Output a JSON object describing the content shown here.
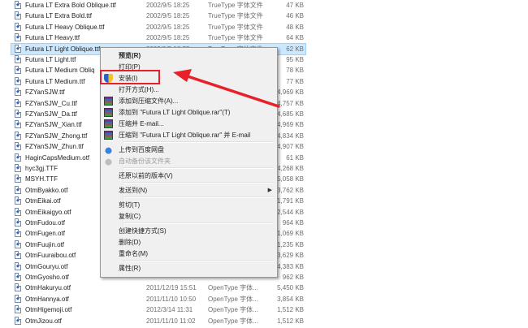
{
  "files": [
    {
      "name": "Futura LT Extra Bold Oblique.ttf",
      "date": "2002/9/5 18:25",
      "type": "TrueType 字体文件",
      "size": "47 KB"
    },
    {
      "name": "Futura LT Extra Bold.ttf",
      "date": "2002/9/5 18:25",
      "type": "TrueType 字体文件",
      "size": "46 KB"
    },
    {
      "name": "Futura LT Heavy Oblique.ttf",
      "date": "2002/9/5 18:25",
      "type": "TrueType 字体文件",
      "size": "48 KB"
    },
    {
      "name": "Futura LT Heavy.ttf",
      "date": "2002/9/5 18:25",
      "type": "TrueType 字体文件",
      "size": "64 KB"
    },
    {
      "name": "Futura LT Light Oblique.ttf",
      "date": "2002/9/5 18:25",
      "type": "TrueType 字体文件",
      "size": "62 KB",
      "selected": true
    },
    {
      "name": "Futura LT Light.ttf",
      "date": "",
      "type": "",
      "size": "95 KB"
    },
    {
      "name": "Futura LT Medium Obliq",
      "date": "",
      "type": "",
      "size": "78 KB"
    },
    {
      "name": "Futura LT Medium.ttf",
      "date": "",
      "type": "",
      "size": "77 KB"
    },
    {
      "name": "FZYanSJW.ttf",
      "date": "",
      "type": "",
      "size": "4,969 KB"
    },
    {
      "name": "FZYanSJW_Cu.ttf",
      "date": "",
      "type": "",
      "size": "4,757 KB"
    },
    {
      "name": "FZYanSJW_Da.ttf",
      "date": "",
      "type": "",
      "size": "4,685 KB"
    },
    {
      "name": "FZYanSJW_Xian.ttf",
      "date": "",
      "type": "",
      "size": "4,969 KB"
    },
    {
      "name": "FZYanSJW_Zhong.ttf",
      "date": "",
      "type": "",
      "size": "4,834 KB"
    },
    {
      "name": "FZYanSJW_Zhun.ttf",
      "date": "",
      "type": "",
      "size": "4,907 KB"
    },
    {
      "name": "HaginCapsMedium.otf",
      "date": "",
      "type": "",
      "size": "61 KB"
    },
    {
      "name": "hyc3gj.TTF",
      "date": "",
      "type": "",
      "size": "4,268 KB"
    },
    {
      "name": "MSYH.TTF",
      "date": "",
      "type": "",
      "size": "15,058 KB"
    },
    {
      "name": "OtmByakko.otf",
      "date": "",
      "type": "",
      "size": "3,762 KB"
    },
    {
      "name": "OtmEikai.otf",
      "date": "",
      "type": "",
      "size": "1,791 KB"
    },
    {
      "name": "OtmEikaigyo.otf",
      "date": "",
      "type": "",
      "size": "2,544 KB"
    },
    {
      "name": "OtmFudou.otf",
      "date": "",
      "type": "",
      "size": "964 KB"
    },
    {
      "name": "OtmFugen.otf",
      "date": "",
      "type": "",
      "size": "1,069 KB"
    },
    {
      "name": "OtmFuujin.otf",
      "date": "",
      "type": "",
      "size": "1,235 KB"
    },
    {
      "name": "OtmFuuraibou.otf",
      "date": "",
      "type": "",
      "size": "3,629 KB"
    },
    {
      "name": "OtmGouryu.otf",
      "date": "",
      "type": "",
      "size": "4,383 KB"
    },
    {
      "name": "OtmGyosho.otf",
      "date": "",
      "type": "",
      "size": "962 KB"
    },
    {
      "name": "OtmHakuryu.otf",
      "date": "2011/12/19 15:51",
      "type": "OpenType 字体...",
      "size": "5,450 KB"
    },
    {
      "name": "OtmHannya.otf",
      "date": "2011/11/10 10:50",
      "type": "OpenType 字体...",
      "size": "3,854 KB"
    },
    {
      "name": "OtmHigemoji.otf",
      "date": "2012/3/14 11:31",
      "type": "OpenType 字体...",
      "size": "1,512 KB"
    },
    {
      "name": "OtmJizou.otf",
      "date": "2011/11/10 11:02",
      "type": "OpenType 字体...",
      "size": "1,512 KB"
    }
  ],
  "context_menu": {
    "items": [
      {
        "label": "预览(R)",
        "bold": true
      },
      {
        "label": "打印(P)"
      },
      {
        "label": "安装(I)",
        "icon": "shield-icon"
      },
      {
        "label": "打开方式(H)..."
      },
      {
        "label": "添加到压缩文件(A)...",
        "icon": "winrar-icon"
      },
      {
        "label": "添加到 \"Futura LT Light Oblique.rar\"(T)",
        "icon": "winrar-icon"
      },
      {
        "label": "压缩并 E-mail...",
        "icon": "winrar-icon"
      },
      {
        "label": "压缩到 \"Futura LT Light Oblique.rar\" 并 E-mail",
        "icon": "winrar-icon"
      },
      {
        "label": "上传到百度网盘",
        "icon": "baidu-cloud-icon"
      },
      {
        "label": "自动备份该文件夹",
        "icon": "baidu-cloud-icon",
        "disabled": true
      },
      {
        "label": "还原以前的版本(V)"
      },
      {
        "label": "发送到(N)",
        "submenu": true
      },
      {
        "label": "剪切(T)"
      },
      {
        "label": "复制(C)"
      },
      {
        "label": "创建快捷方式(S)"
      },
      {
        "label": "删除(D)"
      },
      {
        "label": "重命名(M)"
      },
      {
        "label": "属性(R)"
      }
    ]
  },
  "colors": {
    "annotation": "#e8202a",
    "selection": "#cce8ff"
  }
}
